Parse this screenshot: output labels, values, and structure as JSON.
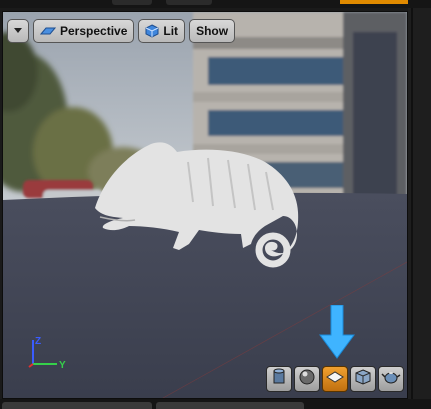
{
  "toolbar": {
    "menu_icon": "chevron-down-icon",
    "perspective_label": "Perspective",
    "perspective_icon": "perspective-icon",
    "lit_label": "Lit",
    "lit_icon": "cube-icon",
    "show_label": "Show"
  },
  "axis": {
    "z_label": "Z",
    "y_label": "Y"
  },
  "view_modes": [
    {
      "icon": "cylinder-icon",
      "active": false
    },
    {
      "icon": "sphere-icon",
      "active": false
    },
    {
      "icon": "plane-icon",
      "active": true
    },
    {
      "icon": "cube-icon",
      "active": false
    },
    {
      "icon": "teapot-icon",
      "active": false
    }
  ],
  "colors": {
    "accent_orange": "#e08a00",
    "highlight_arrow": "#3fb4ff",
    "axis_z": "#3a5cff",
    "axis_y": "#35d04a",
    "axis_x": "#e03030"
  }
}
